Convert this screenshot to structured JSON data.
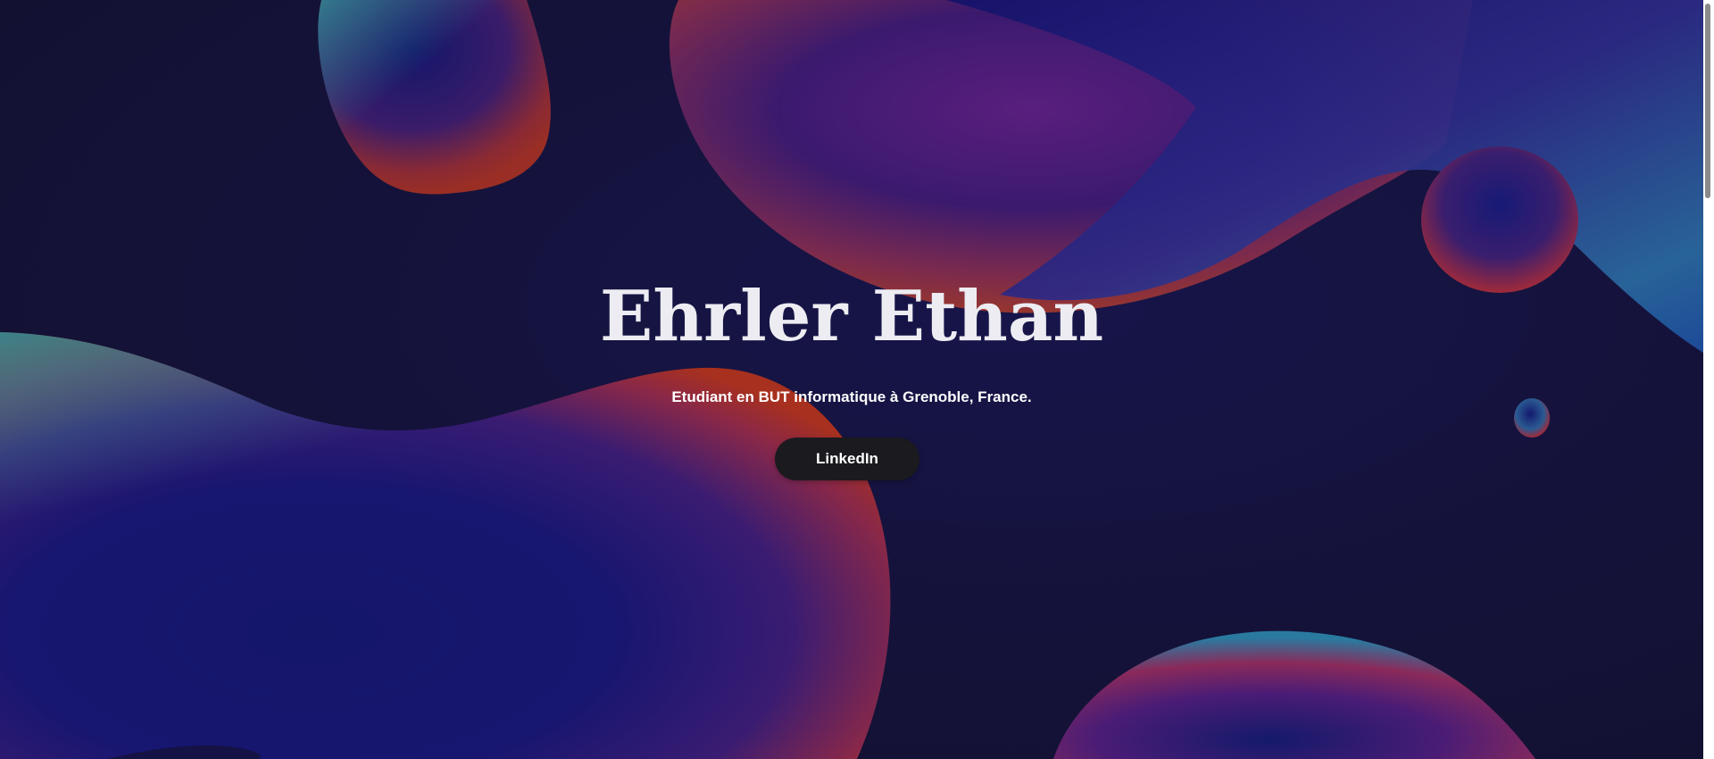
{
  "hero": {
    "title": "Ehrler Ethan",
    "subtitle": "Etudiant en BUT informatique à Grenoble, France.",
    "linkedin_label": "LinkedIn"
  },
  "colors": {
    "background": "#141238",
    "blob_blue": "#12166a",
    "blob_purple": "#5a1e7e",
    "blob_red": "#9a2a28",
    "blob_teal": "#2a6e92",
    "title_text": "#ececf2",
    "button_bg": "#1b1a1f",
    "button_text": "#ffffff"
  }
}
